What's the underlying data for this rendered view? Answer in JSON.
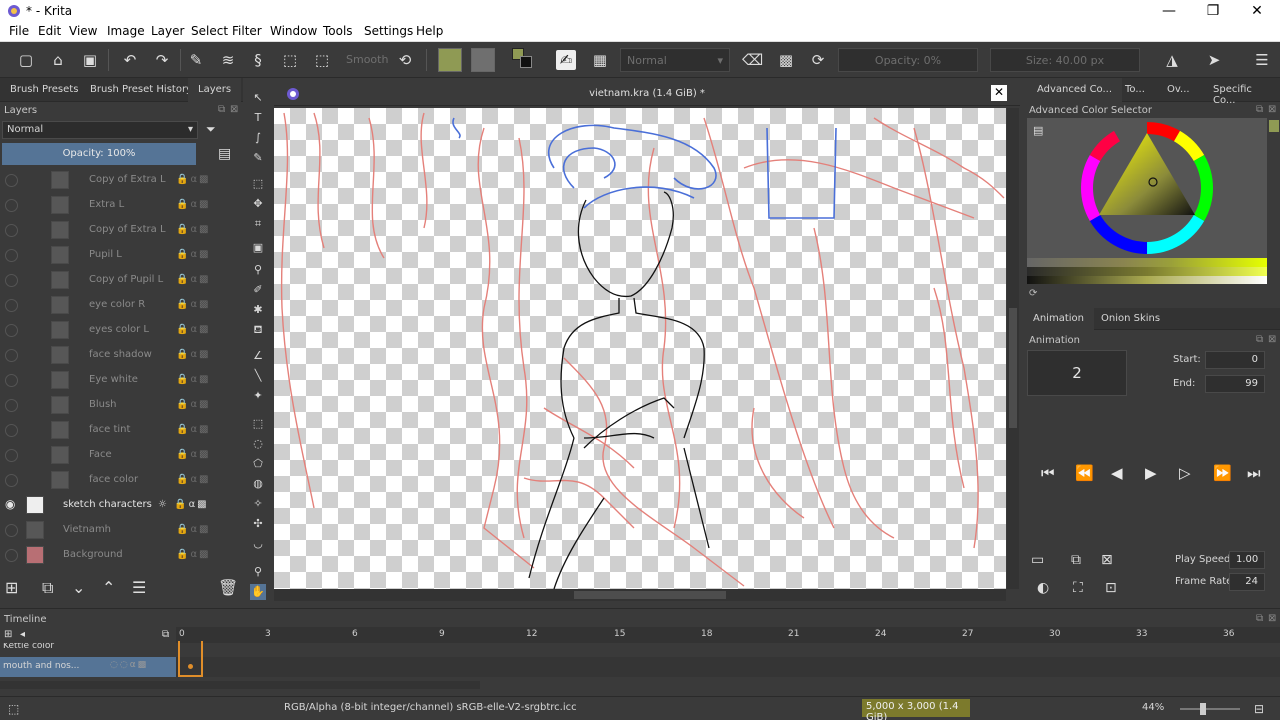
{
  "window": {
    "title": "* - Krita",
    "minimize": "—",
    "restore": "❐",
    "close": "✕"
  },
  "menu": [
    "File",
    "Edit",
    "View",
    "Image",
    "Layer",
    "Select",
    "Filter",
    "Window",
    "Tools",
    "Settings",
    "Help"
  ],
  "toolbar": {
    "smooth_label": "Smooth",
    "blend_mode": "Normal",
    "opacity": "Opacity: 0%",
    "size": "Size: 40.00 px"
  },
  "left_dock": {
    "tabs": [
      "Brush Presets",
      "Brush Preset History",
      "Layers"
    ],
    "layers_title": "Layers",
    "blend_mode": "Normal",
    "opacity": "Opacity:  100%",
    "layers": [
      {
        "name": "Copy of Extra L",
        "visible": false
      },
      {
        "name": "Extra L",
        "visible": false
      },
      {
        "name": "Copy of Extra L",
        "visible": false
      },
      {
        "name": "Pupil L",
        "visible": false
      },
      {
        "name": "Copy of Pupil L",
        "visible": false
      },
      {
        "name": "eye color R",
        "visible": false
      },
      {
        "name": "eyes color L",
        "visible": false
      },
      {
        "name": "face shadow",
        "visible": false
      },
      {
        "name": "Eye white",
        "visible": false
      },
      {
        "name": "Blush",
        "visible": false
      },
      {
        "name": "face tint",
        "visible": false
      },
      {
        "name": "Face",
        "visible": false
      },
      {
        "name": "face color",
        "visible": false
      },
      {
        "name": "sketch characters",
        "visible": true
      },
      {
        "name": "Vietnamh",
        "visible": false
      },
      {
        "name": "Background",
        "visible": false
      }
    ]
  },
  "canvas": {
    "doc_title": "vietnam.kra (1.4 GiB) *"
  },
  "right_dock": {
    "tabs": [
      "Advanced Co...",
      "To...",
      "Ov...",
      "Specific Co..."
    ],
    "color_selector_title": "Advanced Color Selector",
    "anim_tabs": [
      "Animation",
      "Onion Skins"
    ],
    "animation_title": "Animation",
    "current_frame": "2",
    "start_label": "Start:",
    "start_value": "0",
    "end_label": "End:",
    "end_value": "99",
    "play_speed_label": "Play Speed:",
    "play_speed_value": "1.00",
    "frame_rate_label": "Frame Rate:",
    "frame_rate_value": "24"
  },
  "timeline": {
    "title": "Timeline",
    "ruler": [
      "0",
      "3",
      "6",
      "9",
      "12",
      "15",
      "18",
      "21",
      "24",
      "27",
      "30",
      "33",
      "36"
    ],
    "rows": [
      "Kettle color",
      "mouth and nos..."
    ]
  },
  "status": {
    "color_space": "RGB/Alpha (8-bit integer/channel)  sRGB-elle-V2-srgbtrc.icc",
    "image_size": "5,000 x 3,000 (1.4 GiB)",
    "zoom": "44%"
  },
  "colors": {
    "accent": "#557496",
    "playhead": "#e08e2a",
    "sketch_red": "#e4807a",
    "sketch_blue": "#4a6fd8"
  }
}
